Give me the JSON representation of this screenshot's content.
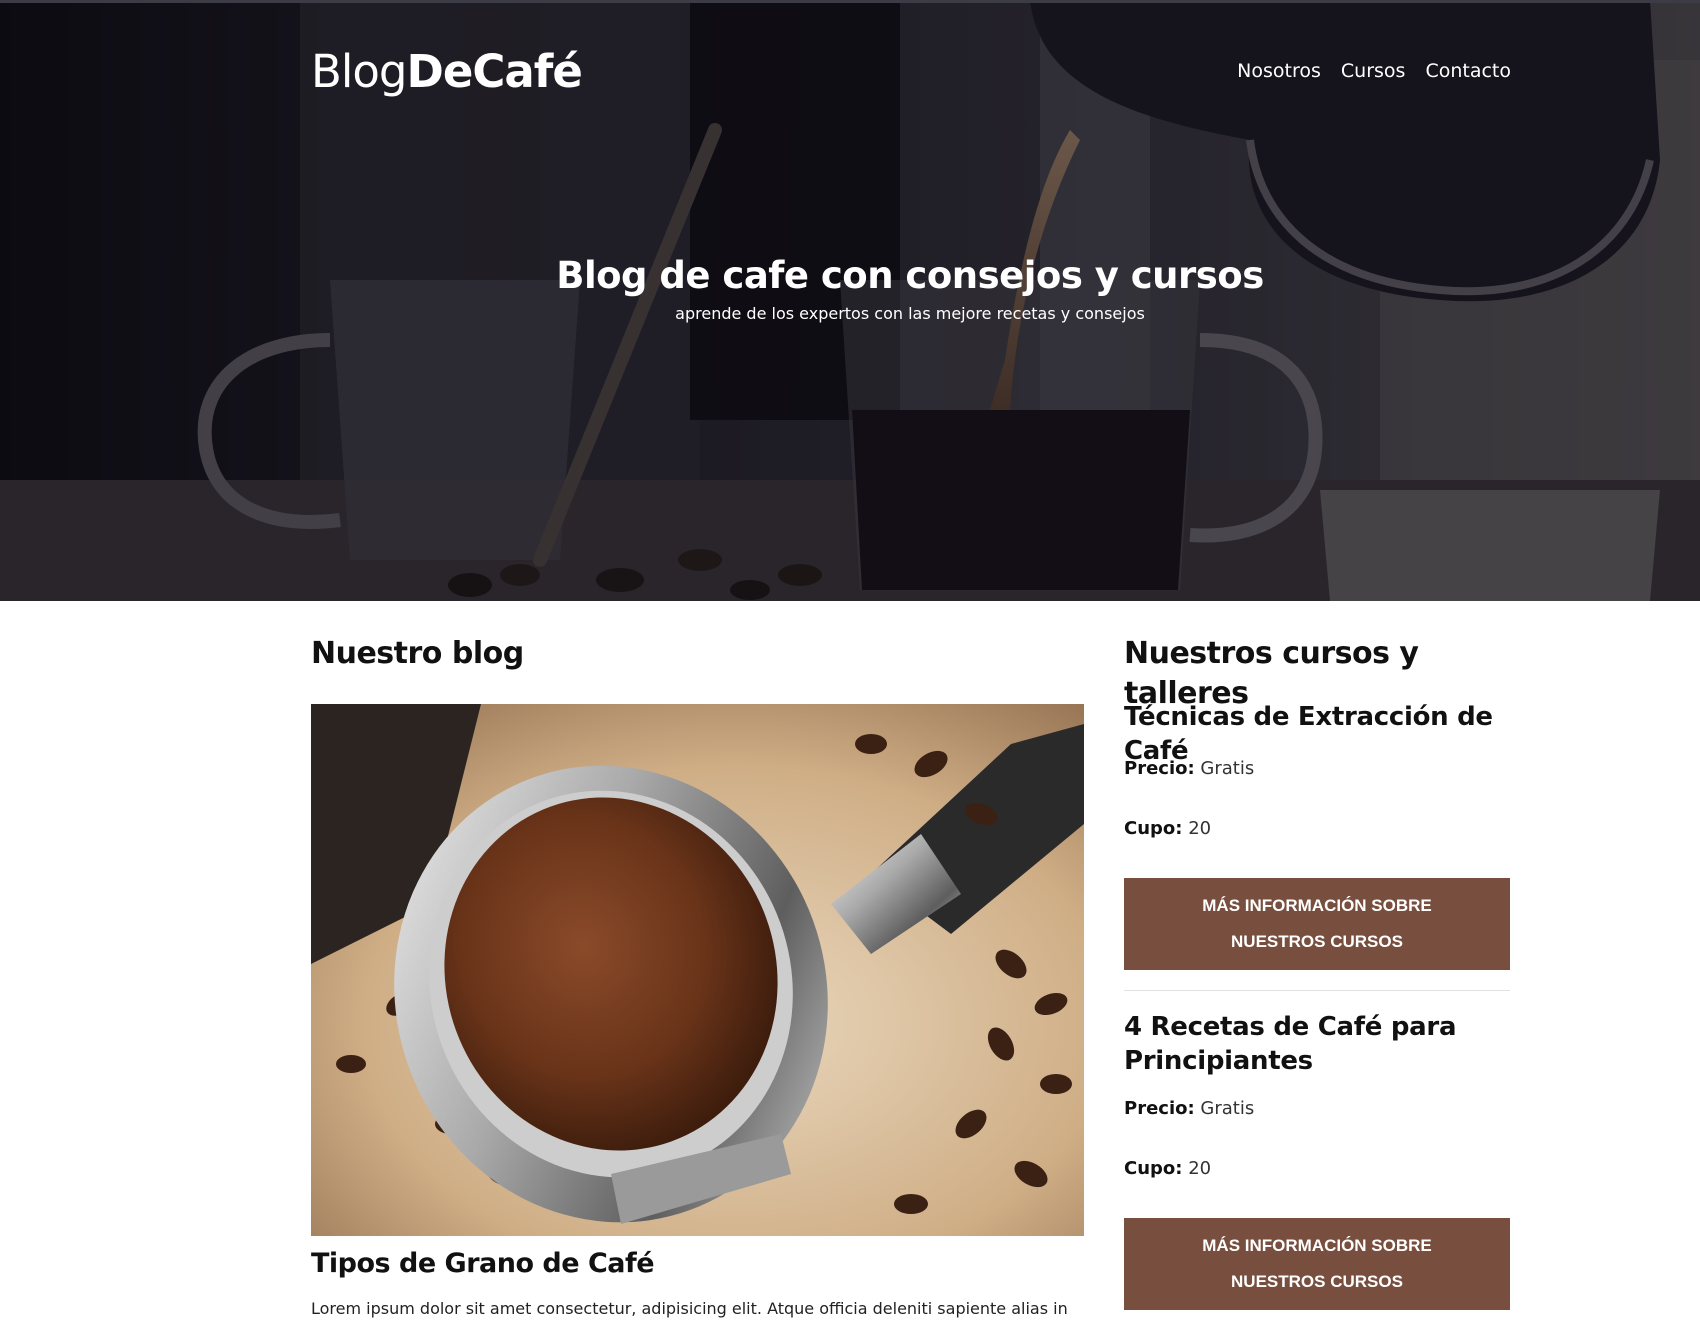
{
  "site": {
    "logo_light": "Blog",
    "logo_bold": "DeCafé"
  },
  "nav": {
    "items": [
      "Nosotros",
      "Cursos",
      "Contacto"
    ]
  },
  "hero": {
    "title": "Blog de cafe con consejos y cursos",
    "subtitle": "aprende de los expertos con las mejore recetas y consejos"
  },
  "blog": {
    "heading": "Nuestro blog",
    "posts": [
      {
        "title": "Tipos de Grano de Café",
        "excerpt": "Lorem ipsum dolor sit amet consectetur, adipisicing elit. Atque officia deleniti sapiente alias in"
      }
    ]
  },
  "courses": {
    "heading": "Nuestros cursos y talleres",
    "price_label": "Precio:",
    "quota_label": "Cupo:",
    "button_label": "Más información sobre nuestros cursos",
    "items": [
      {
        "title": "Técnicas de Extracción de Café",
        "price": "Gratis",
        "quota": "20"
      },
      {
        "title": "4 Recetas de Café para Principiantes",
        "price": "Gratis",
        "quota": "20"
      }
    ]
  },
  "colors": {
    "button_bg": "#784f3e",
    "hero_overlay": "#0f0e16",
    "text": "#111111"
  }
}
